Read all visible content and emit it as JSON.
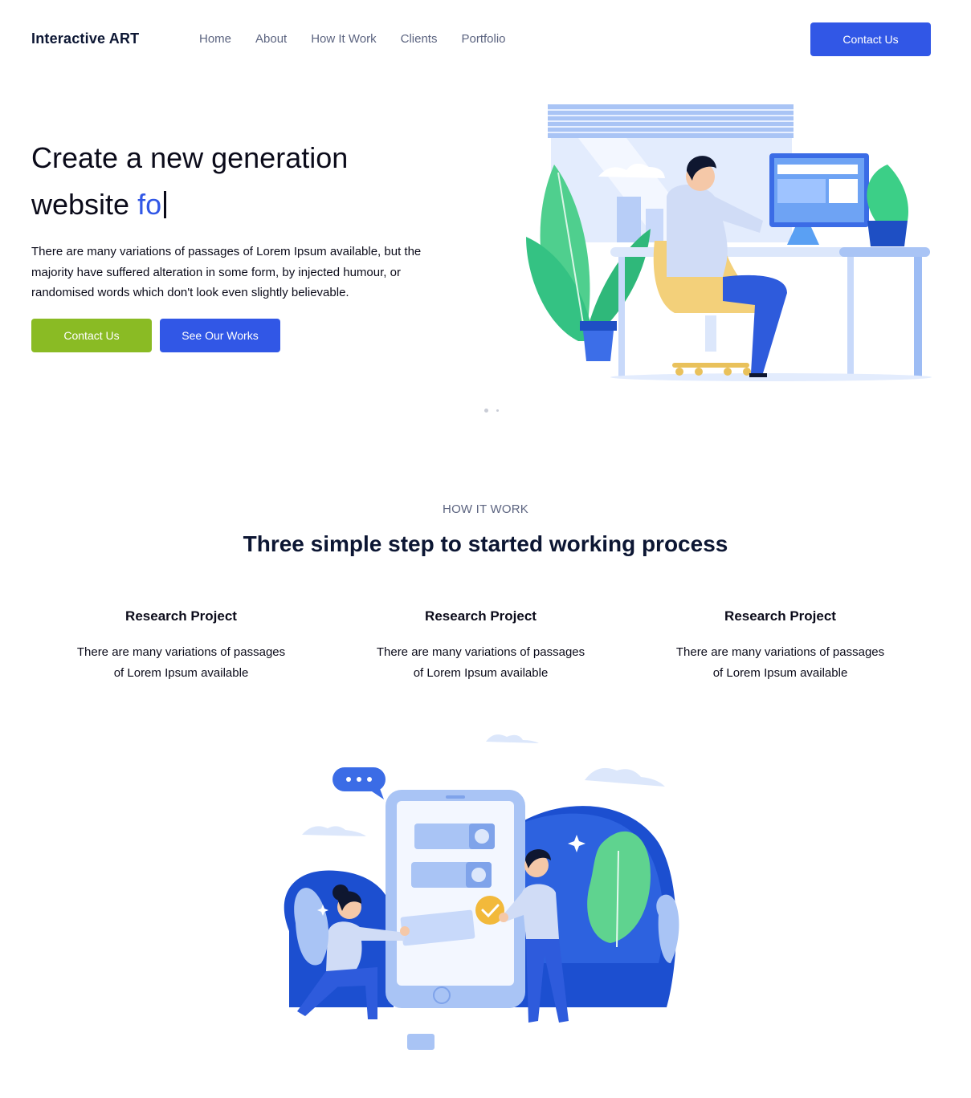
{
  "header": {
    "logo": "Interactive ART",
    "nav": [
      "Home",
      "About",
      "How It Work",
      "Clients",
      "Portfolio"
    ],
    "cta": "Contact Us"
  },
  "hero": {
    "title_line1": "Create a new generation",
    "title_line2_prefix": "website ",
    "title_line2_typed": "fo",
    "description": "There are many variations of passages of Lorem Ipsum available, but the majority have suffered alteration in some form, by injected humour, or randomised words which don't look even slightly believable.",
    "btn_primary": "Contact Us",
    "btn_secondary": "See Our Works"
  },
  "how_it_work": {
    "kicker": "HOW IT WORK",
    "title": "Three simple step to started working process",
    "steps": [
      {
        "title": "Research Project",
        "text": "There are many variations of passages of Lorem Ipsum available"
      },
      {
        "title": "Research Project",
        "text": "There are many variations of passages of Lorem Ipsum available"
      },
      {
        "title": "Research Project",
        "text": "There are many variations of passages of Lorem Ipsum available"
      }
    ]
  },
  "colors": {
    "primary": "#3157e6",
    "green": "#8abb24",
    "text": "#0b0b1a",
    "muted": "#5c6480"
  }
}
